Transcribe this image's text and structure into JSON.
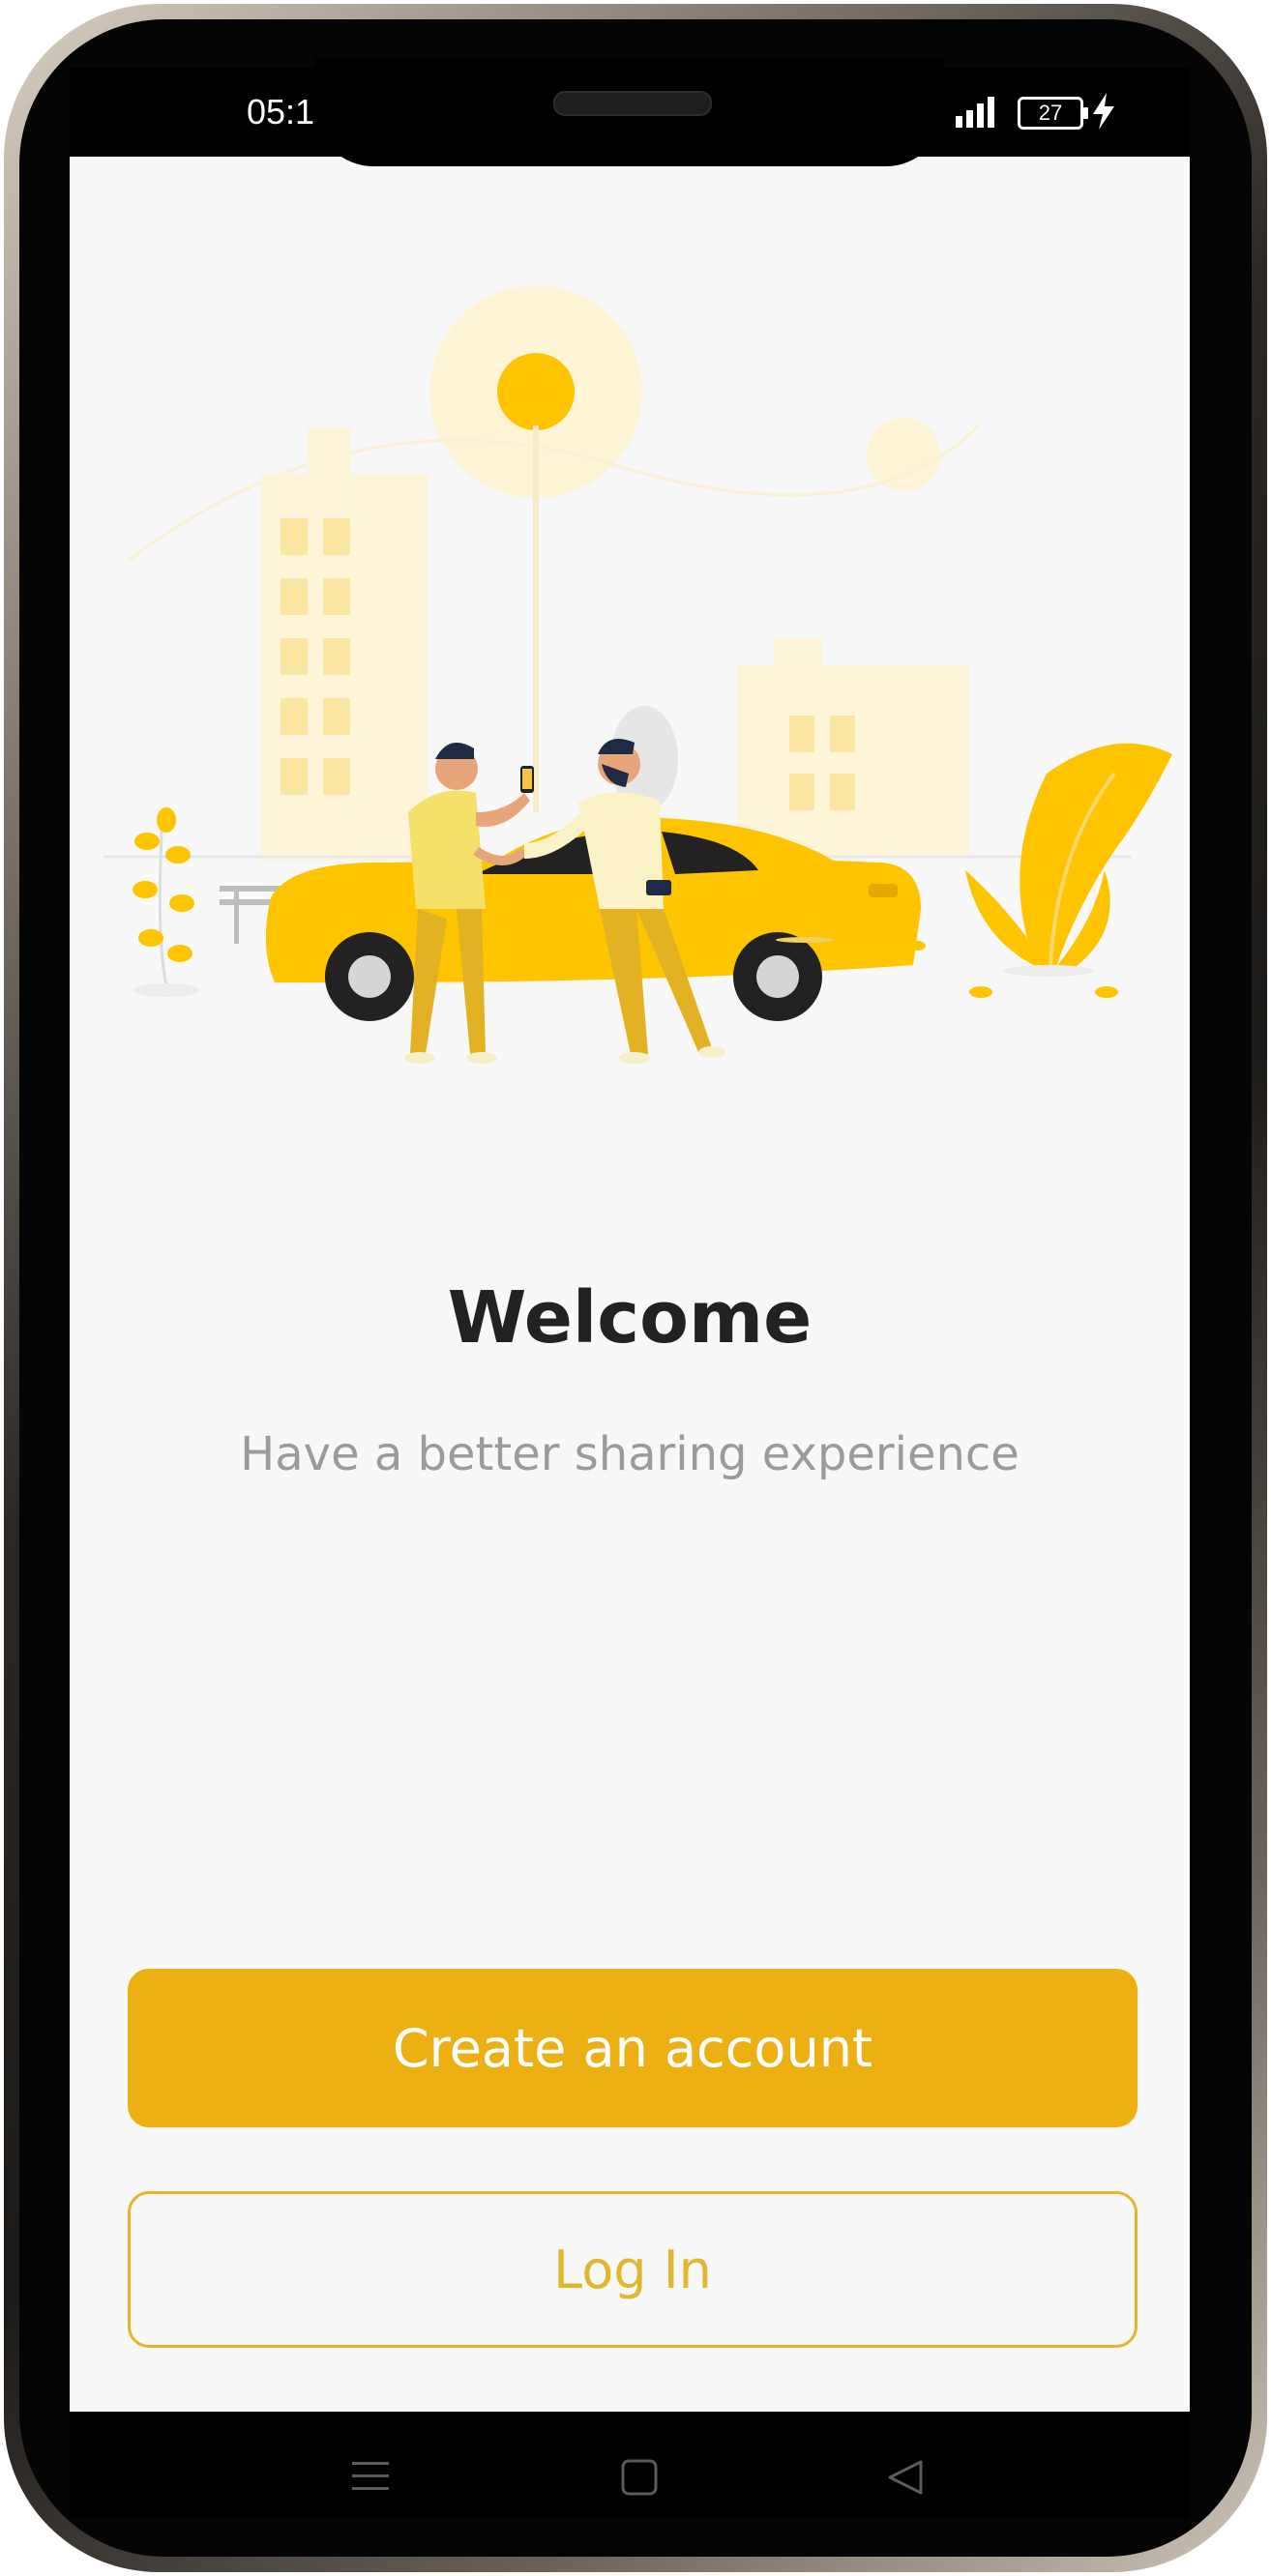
{
  "status_bar": {
    "time": "05:1",
    "battery_level": "27",
    "signal_icon": "cellular-signal-icon",
    "charging_icon": "lightning-bolt-icon"
  },
  "illustration": {
    "description_icon": "car-sharing-illustration",
    "accent_color": "#FFC300"
  },
  "welcome": {
    "title": "Welcome",
    "subtitle": "Have a better sharing experience"
  },
  "buttons": {
    "create_account": "Create an account",
    "log_in": "Log In"
  },
  "navigation_bar": {
    "menu_icon": "menu-lines-icon",
    "home_icon": "square-home-icon",
    "back_icon": "triangle-back-icon"
  },
  "colors": {
    "primary": "#ECB013",
    "outline": "#E4B62C",
    "background": "#F8F8F8",
    "title": "#222222",
    "subtitle": "#9B9B9B"
  }
}
